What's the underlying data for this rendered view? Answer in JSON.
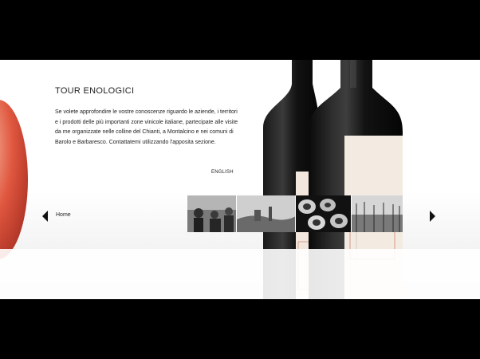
{
  "page": {
    "title": "TOUR ENOLOGICI",
    "paragraph": "Se volete approfondire le vostre conoscenze riguardo le aziende, i territori e i prodotti delle più importanti zone vinicole italiane, partecipate alle visite da me organizzate nelle colline del Chianti, a Montalcino e nei comuni di Barolo e Barbaresco. Contattatemi utilizzando l'apposita sezione.",
    "language_link": "ENGLISH"
  },
  "footer": {
    "home_label": "Home",
    "gallery_thumbnails": [
      "photo-1",
      "photo-2",
      "photo-3",
      "photo-4"
    ]
  },
  "icons": {
    "prev": "arrow-left-icon",
    "next": "arrow-right-icon"
  },
  "colors": {
    "background": "#000000",
    "text": "#222222",
    "accent_red": "#c24a39"
  }
}
